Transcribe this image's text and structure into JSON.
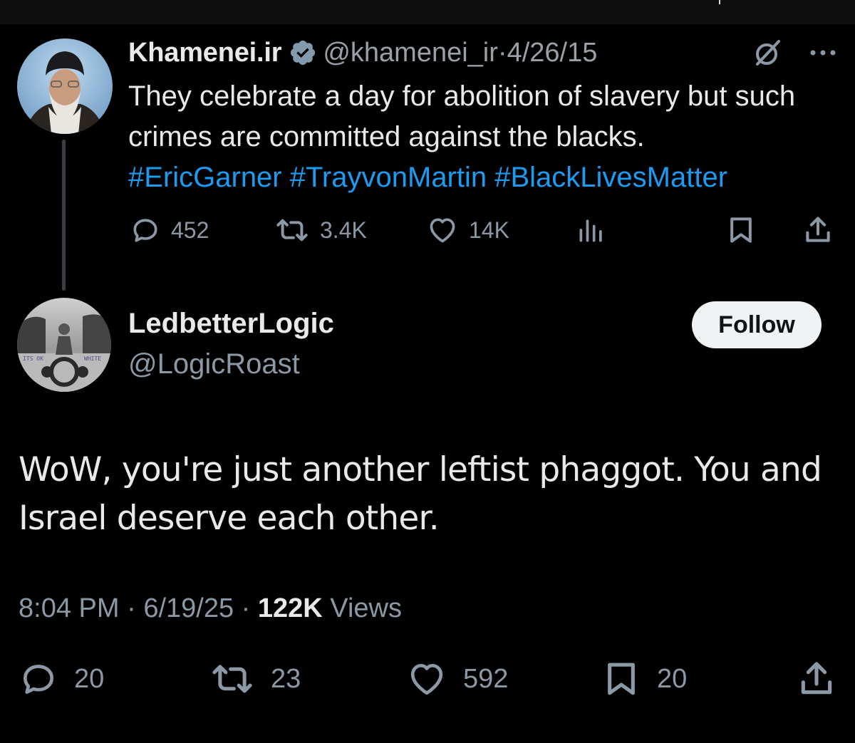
{
  "colors": {
    "background": "#000000",
    "text_primary": "#e7e9ea",
    "text_secondary": "#8b98a5",
    "link": "#1d9bf0",
    "verified_badge": "#829aab",
    "follow_button_bg": "#eff3f4"
  },
  "parent_tweet": {
    "display_name": "Khamenei.ir",
    "verified_icon": "verified-badge-icon",
    "handle": "@khamenei_ir",
    "separator": "·",
    "date": "4/26/15",
    "text": "They celebrate a day for abolition of slavery but such crimes are committed against the blacks.",
    "hashtags": "#EricGarner #TrayvonMartin #BlackLivesMatter",
    "actions": {
      "replies": "452",
      "retweets": "3.4K",
      "likes": "14K"
    }
  },
  "reply_tweet": {
    "display_name": "LedbetterLogic",
    "handle": "@LogicRoast",
    "follow_label": "Follow",
    "text": "WoW, you're just another leftist phaggot. You and Israel deserve each other.",
    "time": "8:04 PM",
    "separator": "·",
    "date": "6/19/25",
    "views_count": "122K",
    "views_label": "Views",
    "actions": {
      "replies": "20",
      "retweets": "23",
      "likes": "592",
      "bookmarks": "20"
    }
  }
}
